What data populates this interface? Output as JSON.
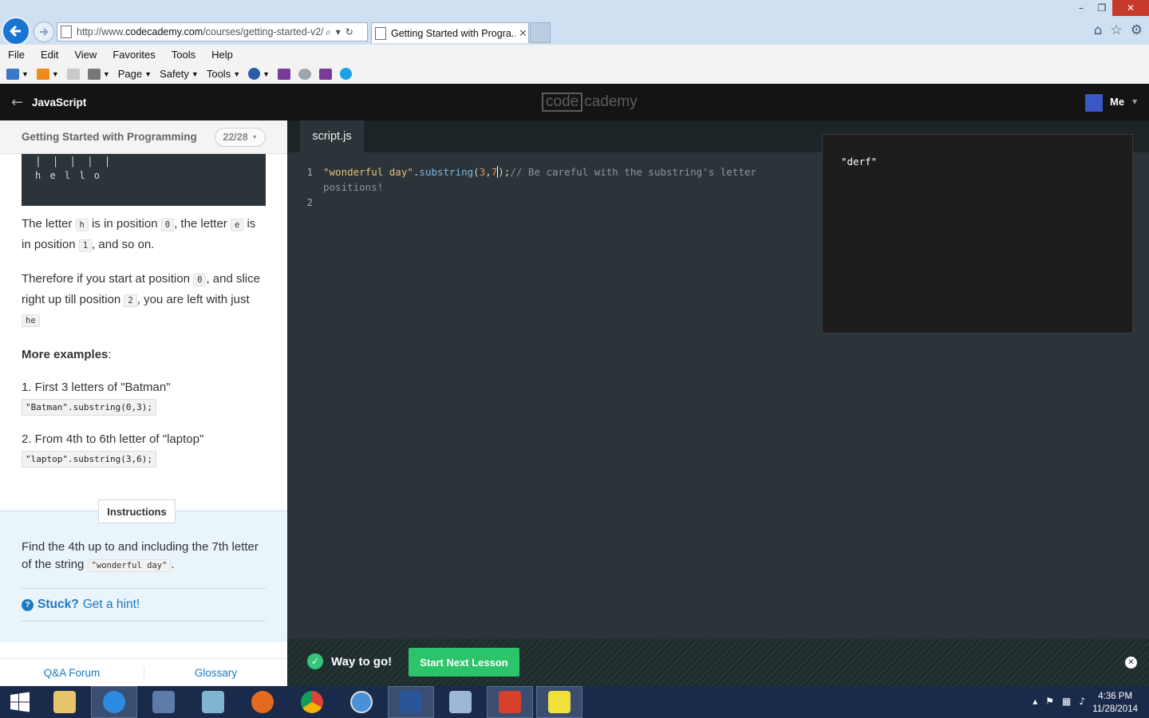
{
  "browser": {
    "url_prefix": "http://www.",
    "url_host": "codecademy.com",
    "url_path": "/courses/getting-started-v2/",
    "tab_title": "Getting Started with Progra...",
    "menu": [
      "File",
      "Edit",
      "View",
      "Favorites",
      "Tools",
      "Help"
    ],
    "command_bar": {
      "page": "Page",
      "safety": "Safety",
      "tools": "Tools"
    }
  },
  "header": {
    "course": "JavaScript",
    "logo_code": "code",
    "logo_rest": "cademy",
    "user": "Me"
  },
  "lesson": {
    "title": "Getting Started with Programming",
    "progress": "22/28",
    "snippet_bars": "| | | | |",
    "snippet_hello": "h e l l o",
    "p1": {
      "a": "The letter ",
      "c1": "h",
      "b": " is in position ",
      "c2": "0",
      "c": ", the letter ",
      "c3": "e",
      "d": " is in position ",
      "c4": "1",
      "e": ", and so on."
    },
    "p2": {
      "a": "Therefore if you start at position ",
      "c1": "0",
      "b": ", and slice right up till position ",
      "c2": "2",
      "c": ", you are left with just ",
      "c3": "he"
    },
    "more_examples": "More examples",
    "more_examples_colon": ":",
    "ex1_text": "1. First 3 letters of \"Batman\"",
    "ex1_code": "\"Batman\".substring(0,3);",
    "ex2_text": "2. From 4th to 6th letter of \"laptop\"",
    "ex2_code": "\"laptop\".substring(3,6);"
  },
  "instructions": {
    "label": "Instructions",
    "text_a": "Find the 4th up to and including the 7th letter of the string ",
    "code": "\"wonderful day\"",
    "text_b": ".",
    "hint_bold": "Stuck?",
    "hint_link": "Get a hint!"
  },
  "footer": {
    "forum": "Q&A Forum",
    "glossary": "Glossary"
  },
  "editor": {
    "tab": "script.js",
    "line_numbers": [
      "1",
      "",
      "2"
    ],
    "tok_str": "\"wonderful day\"",
    "tok_dot": ".",
    "tok_fn": "substring",
    "tok_open": "(",
    "tok_n1": "3",
    "tok_comma": ",",
    "tok_n2": "7",
    "tok_close": ");",
    "tok_comment": "// Be careful with the substring's letter",
    "tok_comment2": "positions!"
  },
  "console": {
    "output": "\"derf\""
  },
  "success": {
    "message": "Way to go!",
    "button": "Start Next Lesson"
  },
  "taskbar": {
    "time": "4:36 PM",
    "date": "11/28/2014"
  },
  "colors": {
    "accent_green": "#2bc46b",
    "link_blue": "#1c79c0",
    "editor_bg": "#2b3438"
  }
}
